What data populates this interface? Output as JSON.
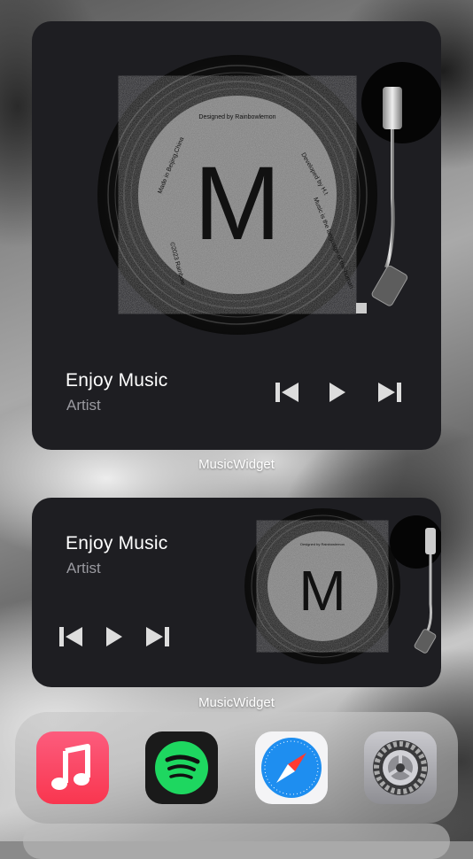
{
  "widgets": [
    {
      "size": "large",
      "track_title": "Enjoy Music",
      "artist": "Artist",
      "label": "MusicWidget"
    },
    {
      "size": "medium",
      "track_title": "Enjoy Music",
      "artist": "Artist",
      "label": "MusicWidget"
    }
  ],
  "record": {
    "monogram": "M",
    "ring_text": [
      "Designed by Rainbowlemon",
      "Developed by H.t",
      "Music is the language of the human",
      "©2023 Rainbow",
      "Made in Beijing,China"
    ]
  },
  "controls": [
    "previous-icon",
    "play-icon",
    "next-icon"
  ],
  "dock": {
    "apps": [
      {
        "name": "music-app-icon",
        "color": "#fa3c57"
      },
      {
        "name": "spotify-app-icon",
        "color": "#1ed760"
      },
      {
        "name": "safari-app-icon",
        "color": "#1a8cf0"
      },
      {
        "name": "settings-app-icon",
        "color": "#8e8e93"
      }
    ]
  }
}
